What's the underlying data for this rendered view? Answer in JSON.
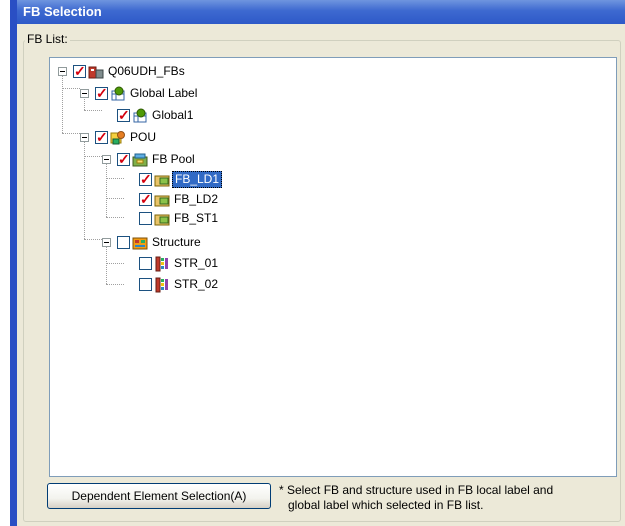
{
  "window": {
    "title": "FB Selection"
  },
  "group": {
    "label": "FB List:"
  },
  "tree": {
    "root": {
      "label": "Q06UDH_FBs",
      "checked": true
    },
    "global_label": {
      "label": "Global Label",
      "checked": true
    },
    "global1": {
      "label": "Global1",
      "checked": true
    },
    "pou": {
      "label": "POU",
      "checked": true
    },
    "fb_pool": {
      "label": "FB Pool",
      "checked": true
    },
    "fb_ld1": {
      "label": "FB_LD1",
      "checked": true,
      "selected": true
    },
    "fb_ld2": {
      "label": "FB_LD2",
      "checked": true
    },
    "fb_st1": {
      "label": "FB_ST1",
      "checked": false
    },
    "structure": {
      "label": "Structure",
      "checked": false
    },
    "str_01": {
      "label": "STR_01",
      "checked": false
    },
    "str_02": {
      "label": "STR_02",
      "checked": false
    }
  },
  "buttons": {
    "dependent_selection": "Dependent Element Selection(A)"
  },
  "note": {
    "line1": "* Select FB and structure used in FB local label and",
    "line2": "global label which selected in FB list."
  },
  "colors": {
    "title_bar": "#2e59c8",
    "selection": "#316ac5",
    "check": "#d4000e"
  }
}
